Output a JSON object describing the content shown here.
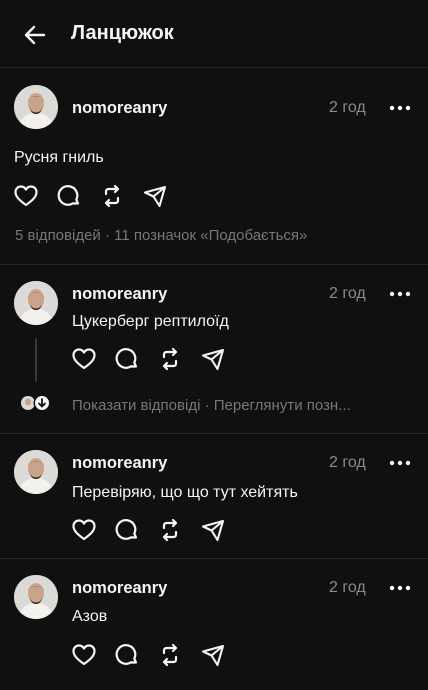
{
  "header": {
    "title": "Ланцюжок",
    "back_icon": "arrow-left-icon"
  },
  "colors": {
    "background": "#101010",
    "text": "#f3f5f7",
    "muted": "#777777",
    "divider": "#262626"
  },
  "main_post": {
    "username": "nomoreanry",
    "time": "2 год",
    "text": "Русня гниль",
    "stats": "5 відповідей · 11 позначок «Подобається»"
  },
  "replies": [
    {
      "username": "nomoreanry",
      "time": "2 год",
      "text": "Цукерберг рептилоїд",
      "show_replies": "Показати відповіді · Переглянути позн..."
    },
    {
      "username": "nomoreanry",
      "time": "2 год",
      "text": "Перевіряю, що що тут хейтять"
    },
    {
      "username": "nomoreanry",
      "time": "2 год",
      "text": "Азов"
    }
  ]
}
